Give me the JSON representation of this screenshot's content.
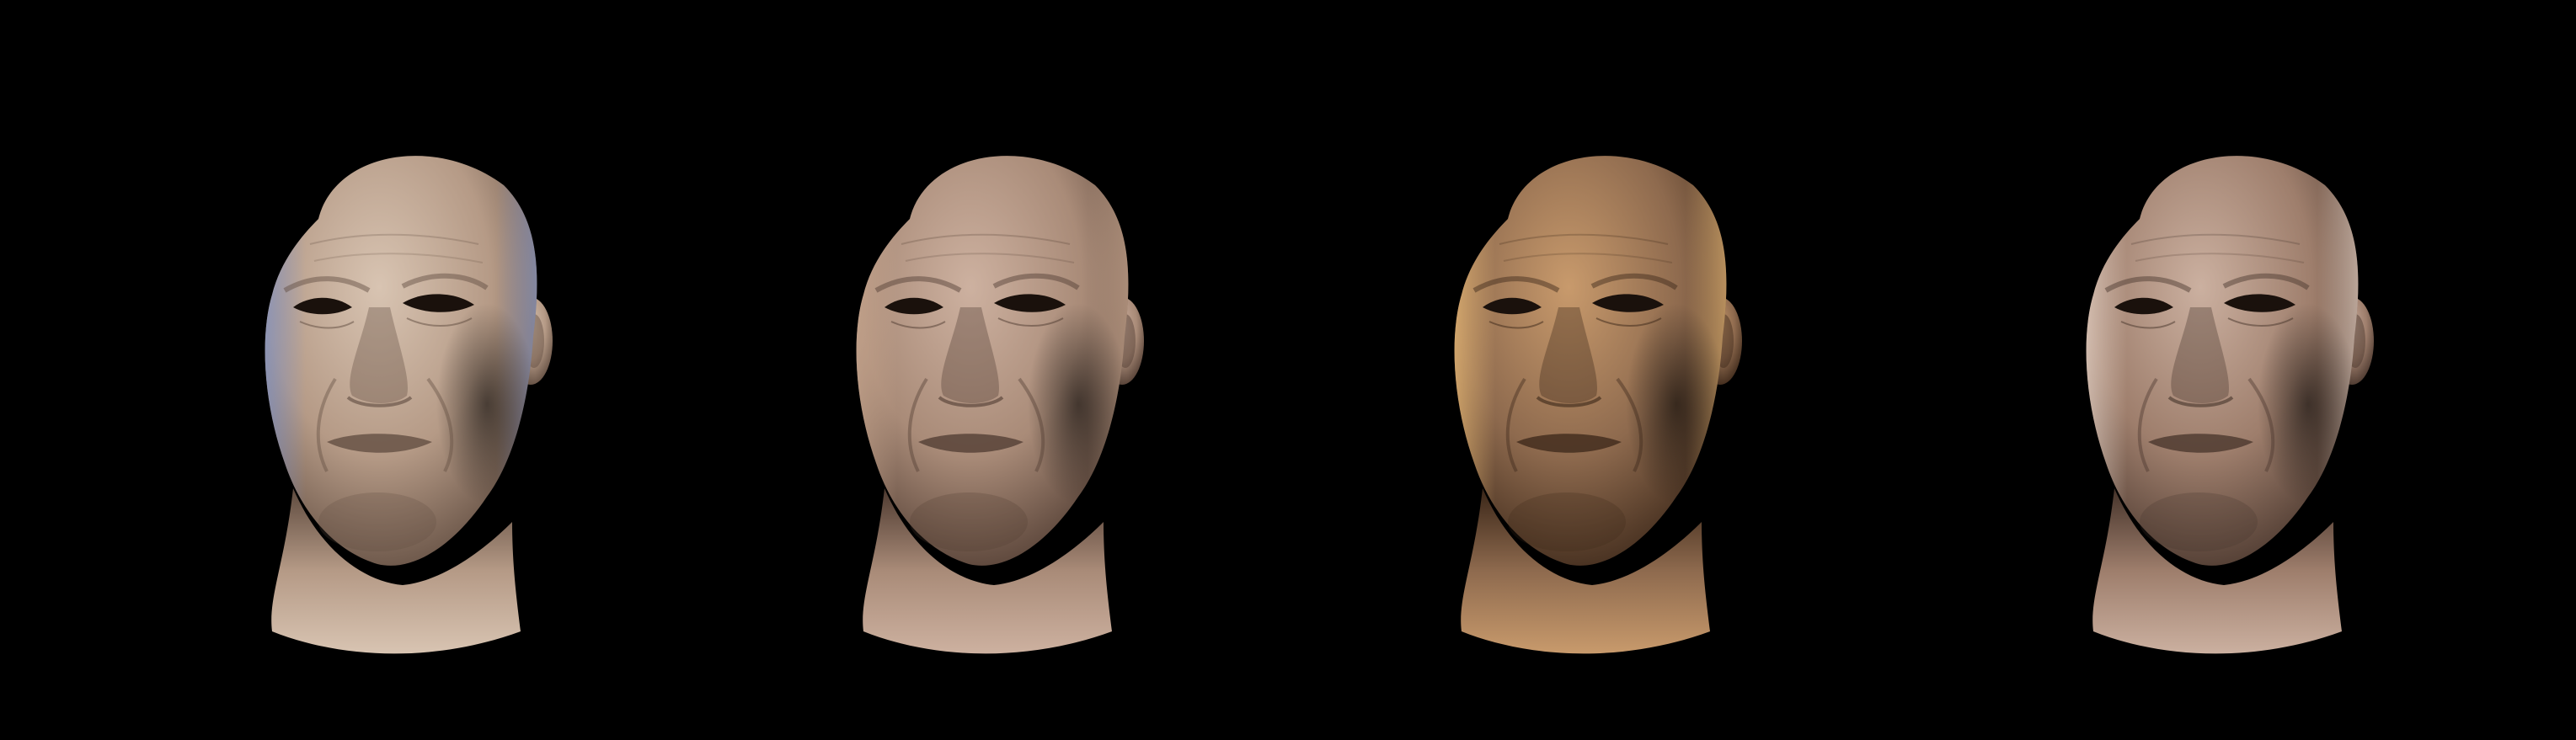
{
  "scene": {
    "background_color": "#000000",
    "renders": [
      {
        "id": "head-1",
        "skin_base": "#b59a86",
        "skin_light": "#d8c4b2",
        "skin_shadow": "#5e4a3e",
        "rim_light": "#7d93c9"
      },
      {
        "id": "head-2",
        "skin_base": "#a98b78",
        "skin_light": "#cdb1a0",
        "skin_shadow": "#4e3a30",
        "rim_light": "#c9a890"
      },
      {
        "id": "head-3",
        "skin_base": "#8e6a4e",
        "skin_light": "#c89a6c",
        "skin_shadow": "#3a2618",
        "rim_light": "#f0c07a"
      },
      {
        "id": "head-4",
        "skin_base": "#9e7e6c",
        "skin_light": "#cbb0a0",
        "skin_shadow": "#45332a",
        "rim_light": "#ead8cc"
      }
    ]
  }
}
